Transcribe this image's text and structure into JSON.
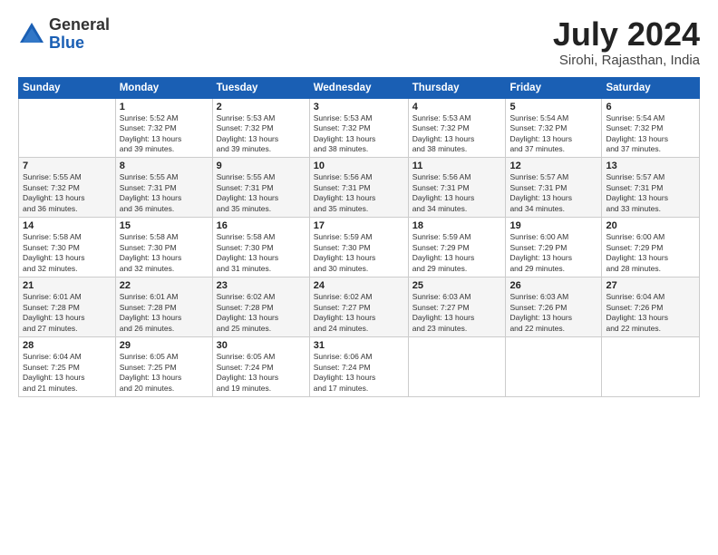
{
  "header": {
    "logo_line1": "General",
    "logo_line2": "Blue",
    "month": "July 2024",
    "location": "Sirohi, Rajasthan, India"
  },
  "weekdays": [
    "Sunday",
    "Monday",
    "Tuesday",
    "Wednesday",
    "Thursday",
    "Friday",
    "Saturday"
  ],
  "weeks": [
    [
      {
        "day": "",
        "info": ""
      },
      {
        "day": "1",
        "info": "Sunrise: 5:52 AM\nSunset: 7:32 PM\nDaylight: 13 hours\nand 39 minutes."
      },
      {
        "day": "2",
        "info": "Sunrise: 5:53 AM\nSunset: 7:32 PM\nDaylight: 13 hours\nand 39 minutes."
      },
      {
        "day": "3",
        "info": "Sunrise: 5:53 AM\nSunset: 7:32 PM\nDaylight: 13 hours\nand 38 minutes."
      },
      {
        "day": "4",
        "info": "Sunrise: 5:53 AM\nSunset: 7:32 PM\nDaylight: 13 hours\nand 38 minutes."
      },
      {
        "day": "5",
        "info": "Sunrise: 5:54 AM\nSunset: 7:32 PM\nDaylight: 13 hours\nand 37 minutes."
      },
      {
        "day": "6",
        "info": "Sunrise: 5:54 AM\nSunset: 7:32 PM\nDaylight: 13 hours\nand 37 minutes."
      }
    ],
    [
      {
        "day": "7",
        "info": "Sunrise: 5:55 AM\nSunset: 7:32 PM\nDaylight: 13 hours\nand 36 minutes."
      },
      {
        "day": "8",
        "info": "Sunrise: 5:55 AM\nSunset: 7:31 PM\nDaylight: 13 hours\nand 36 minutes."
      },
      {
        "day": "9",
        "info": "Sunrise: 5:55 AM\nSunset: 7:31 PM\nDaylight: 13 hours\nand 35 minutes."
      },
      {
        "day": "10",
        "info": "Sunrise: 5:56 AM\nSunset: 7:31 PM\nDaylight: 13 hours\nand 35 minutes."
      },
      {
        "day": "11",
        "info": "Sunrise: 5:56 AM\nSunset: 7:31 PM\nDaylight: 13 hours\nand 34 minutes."
      },
      {
        "day": "12",
        "info": "Sunrise: 5:57 AM\nSunset: 7:31 PM\nDaylight: 13 hours\nand 34 minutes."
      },
      {
        "day": "13",
        "info": "Sunrise: 5:57 AM\nSunset: 7:31 PM\nDaylight: 13 hours\nand 33 minutes."
      }
    ],
    [
      {
        "day": "14",
        "info": "Sunrise: 5:58 AM\nSunset: 7:30 PM\nDaylight: 13 hours\nand 32 minutes."
      },
      {
        "day": "15",
        "info": "Sunrise: 5:58 AM\nSunset: 7:30 PM\nDaylight: 13 hours\nand 32 minutes."
      },
      {
        "day": "16",
        "info": "Sunrise: 5:58 AM\nSunset: 7:30 PM\nDaylight: 13 hours\nand 31 minutes."
      },
      {
        "day": "17",
        "info": "Sunrise: 5:59 AM\nSunset: 7:30 PM\nDaylight: 13 hours\nand 30 minutes."
      },
      {
        "day": "18",
        "info": "Sunrise: 5:59 AM\nSunset: 7:29 PM\nDaylight: 13 hours\nand 29 minutes."
      },
      {
        "day": "19",
        "info": "Sunrise: 6:00 AM\nSunset: 7:29 PM\nDaylight: 13 hours\nand 29 minutes."
      },
      {
        "day": "20",
        "info": "Sunrise: 6:00 AM\nSunset: 7:29 PM\nDaylight: 13 hours\nand 28 minutes."
      }
    ],
    [
      {
        "day": "21",
        "info": "Sunrise: 6:01 AM\nSunset: 7:28 PM\nDaylight: 13 hours\nand 27 minutes."
      },
      {
        "day": "22",
        "info": "Sunrise: 6:01 AM\nSunset: 7:28 PM\nDaylight: 13 hours\nand 26 minutes."
      },
      {
        "day": "23",
        "info": "Sunrise: 6:02 AM\nSunset: 7:28 PM\nDaylight: 13 hours\nand 25 minutes."
      },
      {
        "day": "24",
        "info": "Sunrise: 6:02 AM\nSunset: 7:27 PM\nDaylight: 13 hours\nand 24 minutes."
      },
      {
        "day": "25",
        "info": "Sunrise: 6:03 AM\nSunset: 7:27 PM\nDaylight: 13 hours\nand 23 minutes."
      },
      {
        "day": "26",
        "info": "Sunrise: 6:03 AM\nSunset: 7:26 PM\nDaylight: 13 hours\nand 22 minutes."
      },
      {
        "day": "27",
        "info": "Sunrise: 6:04 AM\nSunset: 7:26 PM\nDaylight: 13 hours\nand 22 minutes."
      }
    ],
    [
      {
        "day": "28",
        "info": "Sunrise: 6:04 AM\nSunset: 7:25 PM\nDaylight: 13 hours\nand 21 minutes."
      },
      {
        "day": "29",
        "info": "Sunrise: 6:05 AM\nSunset: 7:25 PM\nDaylight: 13 hours\nand 20 minutes."
      },
      {
        "day": "30",
        "info": "Sunrise: 6:05 AM\nSunset: 7:24 PM\nDaylight: 13 hours\nand 19 minutes."
      },
      {
        "day": "31",
        "info": "Sunrise: 6:06 AM\nSunset: 7:24 PM\nDaylight: 13 hours\nand 17 minutes."
      },
      {
        "day": "",
        "info": ""
      },
      {
        "day": "",
        "info": ""
      },
      {
        "day": "",
        "info": ""
      }
    ]
  ]
}
